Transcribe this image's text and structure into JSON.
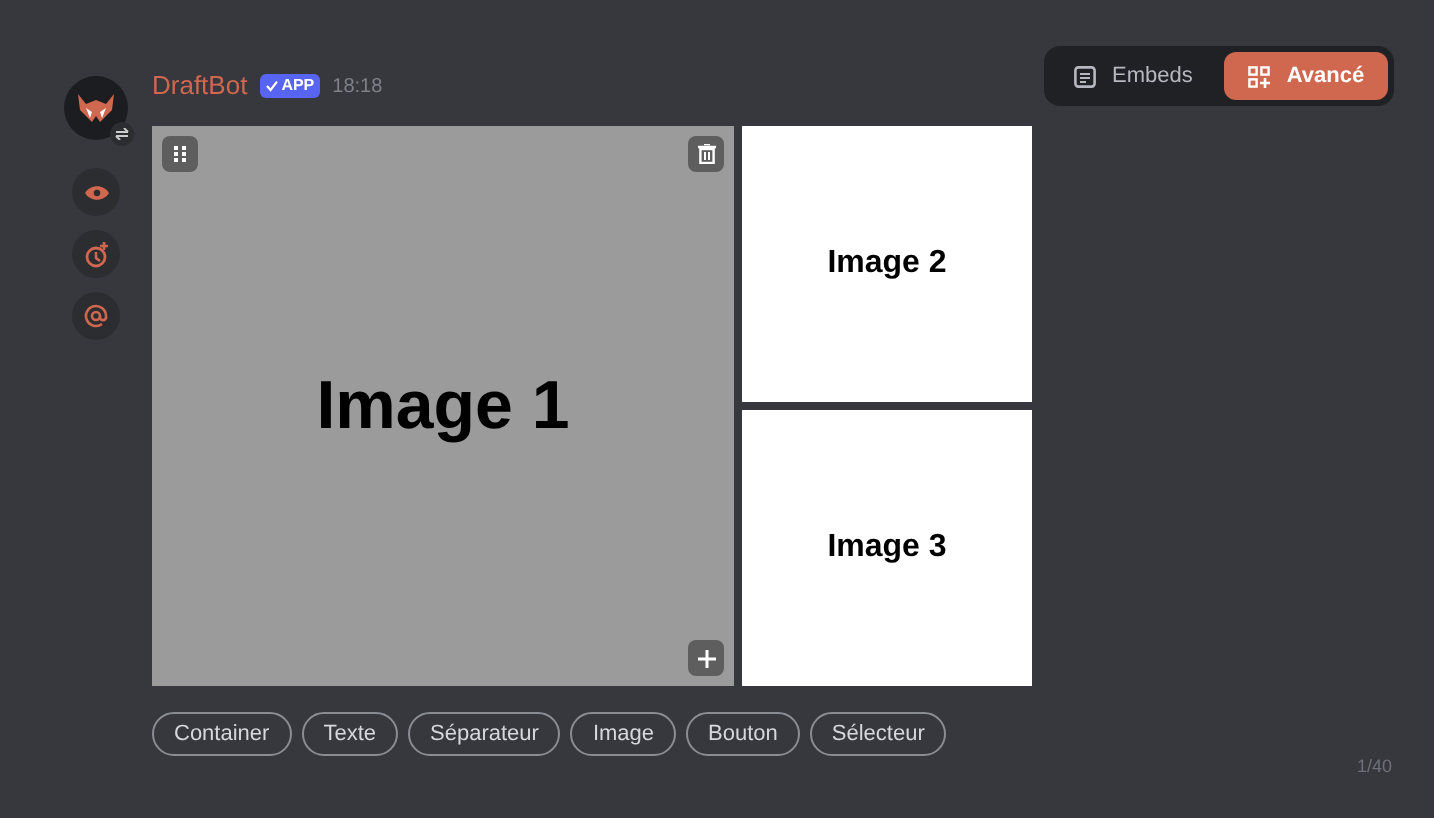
{
  "mode_toggle": [
    {
      "label": "Embeds",
      "selected": false
    },
    {
      "label": "Avancé",
      "selected": true
    }
  ],
  "message": {
    "author": "DraftBot",
    "badge": "APP",
    "time": "18:18"
  },
  "gallery": [
    {
      "label": "Image 1"
    },
    {
      "label": "Image 2"
    },
    {
      "label": "Image 3"
    }
  ],
  "components": [
    "Container",
    "Texte",
    "Séparateur",
    "Image",
    "Bouton",
    "Sélecteur"
  ],
  "counter": "1/40"
}
